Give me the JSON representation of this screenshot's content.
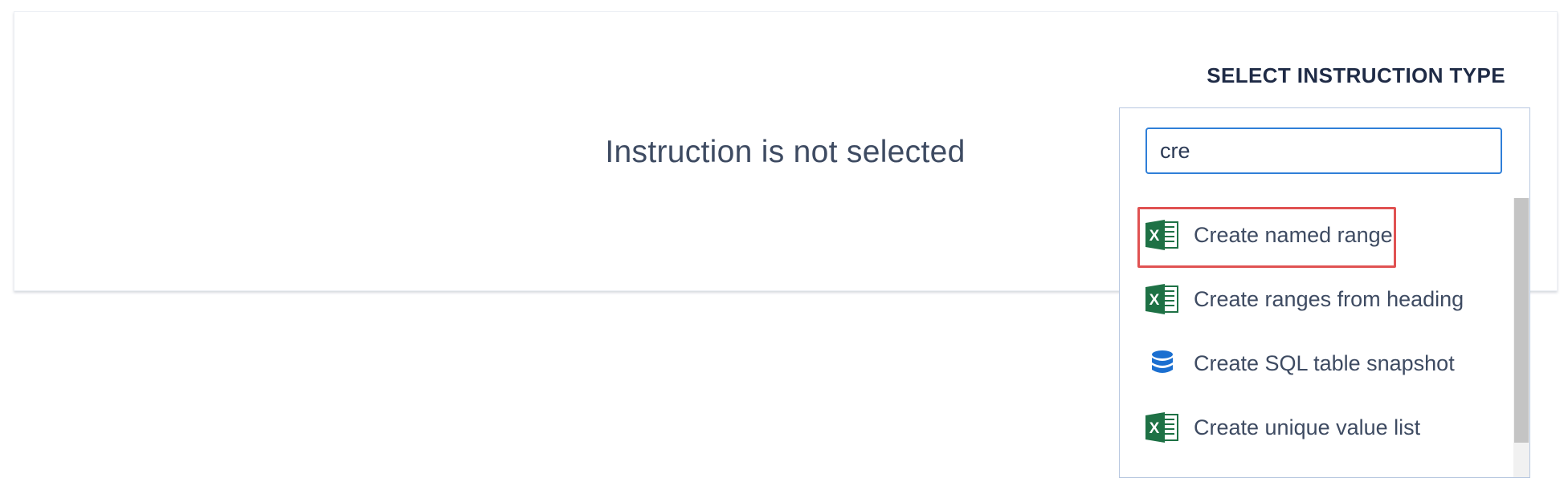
{
  "main": {
    "empty_message": "Instruction is not selected"
  },
  "instruction_picker": {
    "title": "SELECT INSTRUCTION TYPE",
    "search": {
      "value": "cre",
      "placeholder": ""
    },
    "options": [
      {
        "label": "Create named range",
        "icon": "excel-icon",
        "highlighted": true
      },
      {
        "label": "Create ranges from heading",
        "icon": "excel-icon",
        "highlighted": false
      },
      {
        "label": "Create SQL table snapshot",
        "icon": "database-icon",
        "highlighted": false
      },
      {
        "label": "Create unique value list",
        "icon": "excel-icon",
        "highlighted": false
      },
      {
        "label": "",
        "icon": "excel-icon",
        "highlighted": false
      }
    ],
    "colors": {
      "excel_green": "#1e7145",
      "database_blue": "#1b6fd0",
      "focus_border": "#2f7fd8",
      "highlight_border": "#e05252"
    }
  }
}
